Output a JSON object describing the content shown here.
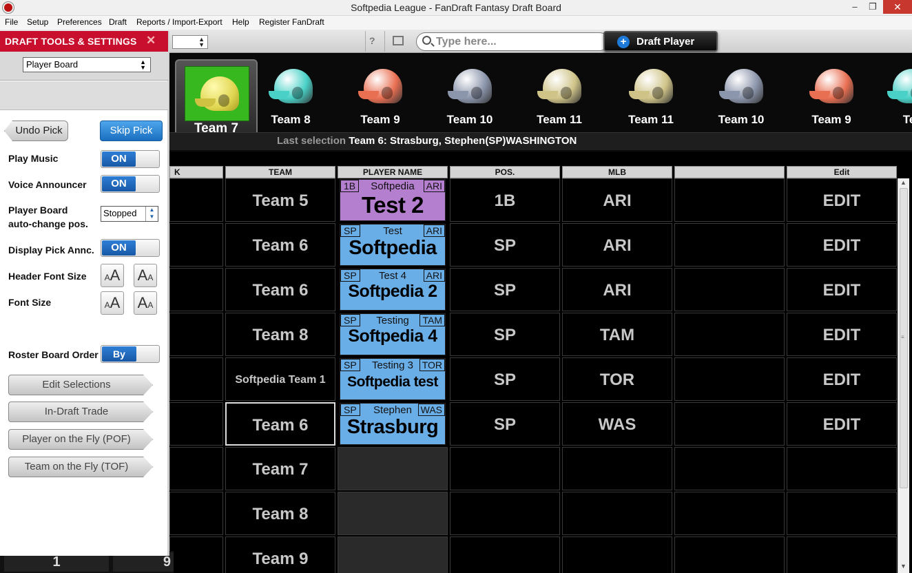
{
  "window": {
    "title": "Softpedia League - FanDraft Fantasy Draft Board",
    "min": "–",
    "max": "❐",
    "close": "✕"
  },
  "menu": [
    "File",
    "Setup",
    "Preferences",
    "Draft",
    "Reports / Import-Export",
    "Help",
    "Register FanDraft"
  ],
  "toolbar": {
    "help": "?",
    "search_placeholder": "Type here...",
    "draft_label": "Draft Player",
    "draft_plus": "+"
  },
  "panel": {
    "title": "DRAFT TOOLS & SETTINGS",
    "close": "✕",
    "view_select": "Player Board",
    "undo": "Undo Pick",
    "skip": "Skip Pick",
    "settings": {
      "play_music": "Play Music",
      "voice": "Voice Announcer",
      "board_pos_1": "Player Board",
      "board_pos_2": "auto-change pos.",
      "display_pick": "Display Pick Annc.",
      "header_font": "Header Font Size",
      "font_size": "Font Size",
      "roster_order": "Roster Board Order"
    },
    "on": "ON",
    "stopped": "Stopped",
    "by_pick": "By Pick",
    "font_small": "A",
    "font_big": "A",
    "buttons": [
      "Edit Selections",
      "In-Draft Trade",
      "Player on the Fly (POF)",
      "Team on the Fly (TOF)"
    ]
  },
  "strip": {
    "current_team": "Team 7",
    "teams": [
      {
        "name": "Team 8",
        "color": "#49d1c7"
      },
      {
        "name": "Team 9",
        "color": "#e96f52"
      },
      {
        "name": "Team 10",
        "color": "#8b95ab"
      },
      {
        "name": "Team 11",
        "color": "#cfc388"
      },
      {
        "name": "Team 11",
        "color": "#cfc388"
      },
      {
        "name": "Team 10",
        "color": "#8b95ab"
      },
      {
        "name": "Team 9",
        "color": "#e96f52"
      },
      {
        "name": "Te",
        "color": "#49d1c7"
      }
    ],
    "last_label": "Last selection",
    "last_value": "Team 6: Strasburg, Stephen(SP)WASHINGTON"
  },
  "grid": {
    "headers": [
      "K",
      "TEAM",
      "PLAYER NAME",
      "POS.",
      "MLB",
      "",
      "Edit"
    ],
    "rows": [
      {
        "team": "Team 5",
        "first": "Softpedia",
        "last": "Test 2",
        "pos": "1B",
        "mlb": "ARI",
        "edit": "EDIT",
        "color": "#b57fd0"
      },
      {
        "team": "Team 6",
        "first": "Test",
        "last": "Softpedia",
        "pos": "SP",
        "mlb": "ARI",
        "edit": "EDIT",
        "color": "#6aaee8"
      },
      {
        "team": "Team 6",
        "first": "Test 4",
        "last": "Softpedia 2",
        "pos": "SP",
        "mlb": "ARI",
        "edit": "EDIT",
        "color": "#6aaee8"
      },
      {
        "team": "Team 8",
        "first": "Testing",
        "last": "Softpedia 4",
        "pos": "SP",
        "mlb": "TAM",
        "edit": "EDIT",
        "color": "#6aaee8"
      },
      {
        "team": "Softpedia Team 1",
        "first": "Testing 3",
        "last": "Softpedia test",
        "pos": "SP",
        "mlb": "TOR",
        "edit": "EDIT",
        "color": "#6aaee8"
      },
      {
        "team": "Team 6",
        "first": "Stephen",
        "last": "Strasburg",
        "pos": "SP",
        "mlb": "WAS",
        "edit": "EDIT",
        "color": "#6aaee8"
      },
      {
        "team": "Team 7"
      },
      {
        "team": "Team 8"
      },
      {
        "team": "Team 9"
      }
    ]
  },
  "bottom": {
    "a": "1",
    "b": "9"
  }
}
